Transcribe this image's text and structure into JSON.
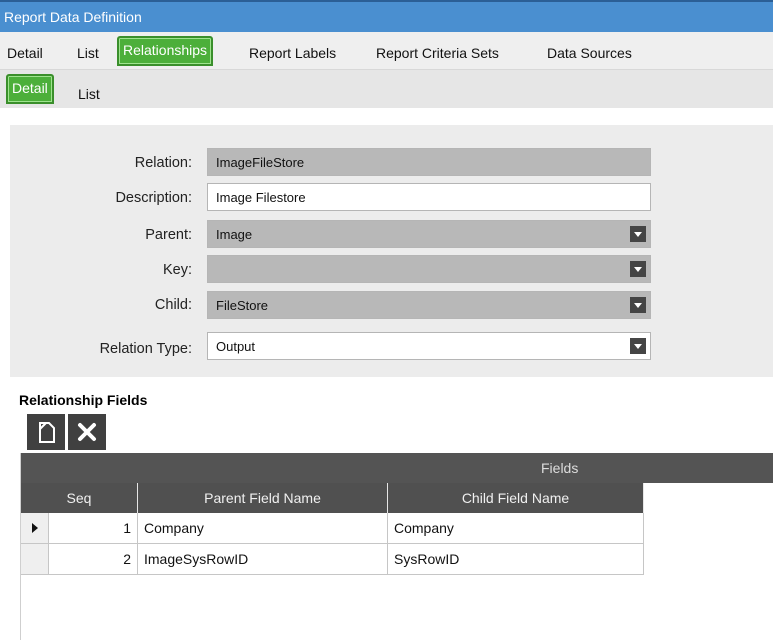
{
  "window": {
    "title": "Report Data Definition"
  },
  "main_tabs": [
    {
      "label": "Detail"
    },
    {
      "label": "List"
    },
    {
      "label": "Relationships",
      "active": true
    },
    {
      "label": "Report Labels"
    },
    {
      "label": "Report Criteria Sets"
    },
    {
      "label": "Data Sources"
    }
  ],
  "sub_tabs": [
    {
      "label": "Detail",
      "active": true
    },
    {
      "label": "List"
    }
  ],
  "form": {
    "relation": {
      "label": "Relation:",
      "value": "ImageFileStore",
      "readonly": true
    },
    "description": {
      "label": "Description:",
      "value": "Image Filestore"
    },
    "parent": {
      "label": "Parent:",
      "value": "Image",
      "readonly": true
    },
    "key": {
      "label": "Key:",
      "value": "",
      "readonly": true
    },
    "child": {
      "label": "Child:",
      "value": "FileStore",
      "readonly": true
    },
    "relation_type": {
      "label": "Relation Type:",
      "value": "Output"
    }
  },
  "relationship_fields": {
    "title": "Relationship Fields",
    "toolbar": {
      "new_icon": "new-document-icon",
      "delete_icon": "delete-x-icon"
    },
    "group_header": "Fields",
    "columns": [
      "Seq",
      "Parent Field Name",
      "Child Field Name"
    ],
    "rows": [
      {
        "seq": "1",
        "parent": "Company",
        "child": "Company"
      },
      {
        "seq": "2",
        "parent": "ImageSysRowID",
        "child": "SysRowID"
      }
    ]
  },
  "colors": {
    "accent_green": "#4caf3a",
    "title_blue": "#4a8fd0",
    "grid_header": "#505050"
  }
}
